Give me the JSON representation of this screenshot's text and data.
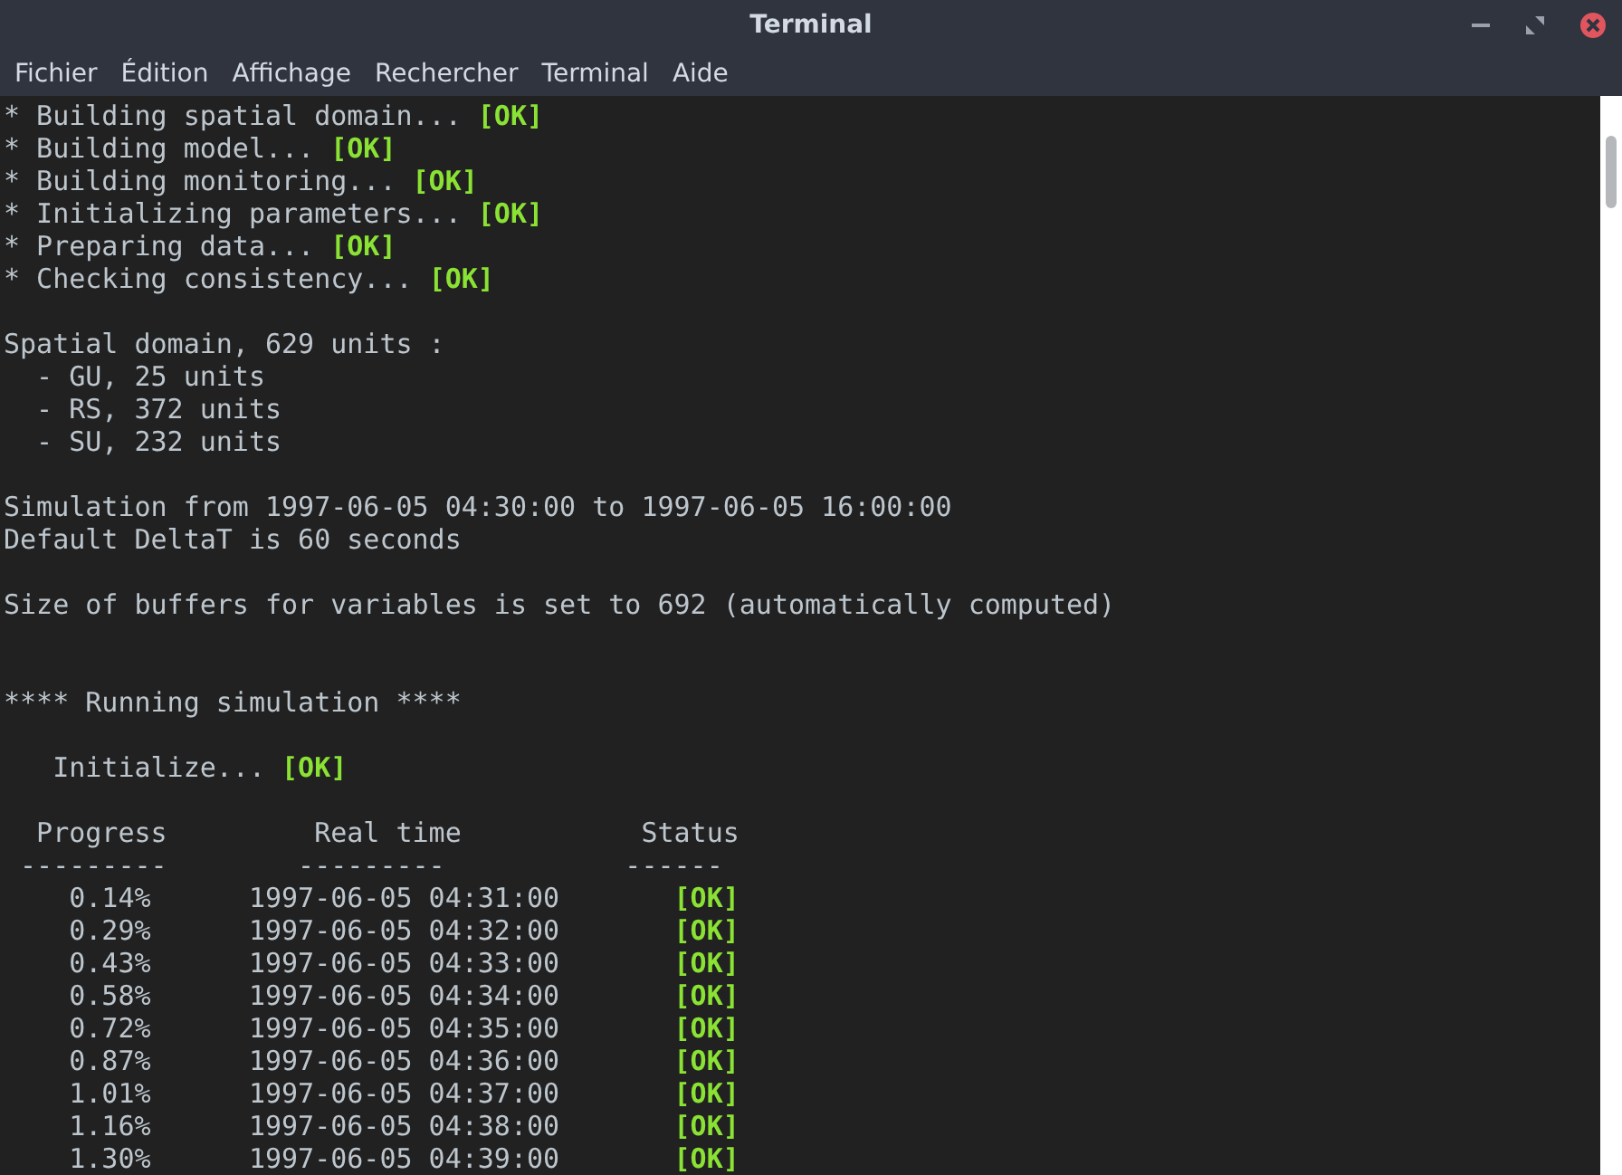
{
  "window": {
    "title": "Terminal"
  },
  "menu": [
    "Fichier",
    "Édition",
    "Affichage",
    "Rechercher",
    "Terminal",
    "Aide"
  ],
  "lines": [
    {
      "kind": "text",
      "text": "* Building spatial domain... ",
      "status": "[OK]"
    },
    {
      "kind": "text",
      "text": "* Building model... ",
      "status": "[OK]"
    },
    {
      "kind": "text",
      "text": "* Building monitoring... ",
      "status": "[OK]"
    },
    {
      "kind": "text",
      "text": "* Initializing parameters... ",
      "status": "[OK]"
    },
    {
      "kind": "text",
      "text": "* Preparing data... ",
      "status": "[OK]"
    },
    {
      "kind": "text",
      "text": "* Checking consistency... ",
      "status": "[OK]"
    },
    {
      "kind": "blank"
    },
    {
      "kind": "text",
      "text": "Spatial domain, 629 units :"
    },
    {
      "kind": "text",
      "text": "  - GU, 25 units"
    },
    {
      "kind": "text",
      "text": "  - RS, 372 units"
    },
    {
      "kind": "text",
      "text": "  - SU, 232 units"
    },
    {
      "kind": "blank"
    },
    {
      "kind": "text",
      "text": "Simulation from 1997-06-05 04:30:00 to 1997-06-05 16:00:00"
    },
    {
      "kind": "text",
      "text": "Default DeltaT is 60 seconds"
    },
    {
      "kind": "blank"
    },
    {
      "kind": "text",
      "text": "Size of buffers for variables is set to 692 (automatically computed)"
    },
    {
      "kind": "blank"
    },
    {
      "kind": "blank"
    },
    {
      "kind": "text",
      "text": "**** Running simulation ****"
    },
    {
      "kind": "blank"
    },
    {
      "kind": "text",
      "text": "   Initialize... ",
      "status": "[OK]"
    },
    {
      "kind": "blank"
    },
    {
      "kind": "text",
      "text": "  Progress         Real time           Status"
    },
    {
      "kind": "text",
      "text": " ---------        ---------           ------"
    },
    {
      "kind": "text",
      "text": "    0.14%      1997-06-05 04:31:00       ",
      "status": "[OK]"
    },
    {
      "kind": "text",
      "text": "    0.29%      1997-06-05 04:32:00       ",
      "status": "[OK]"
    },
    {
      "kind": "text",
      "text": "    0.43%      1997-06-05 04:33:00       ",
      "status": "[OK]"
    },
    {
      "kind": "text",
      "text": "    0.58%      1997-06-05 04:34:00       ",
      "status": "[OK]"
    },
    {
      "kind": "text",
      "text": "    0.72%      1997-06-05 04:35:00       ",
      "status": "[OK]"
    },
    {
      "kind": "text",
      "text": "    0.87%      1997-06-05 04:36:00       ",
      "status": "[OK]"
    },
    {
      "kind": "text",
      "text": "    1.01%      1997-06-05 04:37:00       ",
      "status": "[OK]"
    },
    {
      "kind": "text",
      "text": "    1.16%      1997-06-05 04:38:00       ",
      "status": "[OK]"
    },
    {
      "kind": "text",
      "text": "    1.30%      1997-06-05 04:39:00       ",
      "status": "[OK]"
    }
  ]
}
